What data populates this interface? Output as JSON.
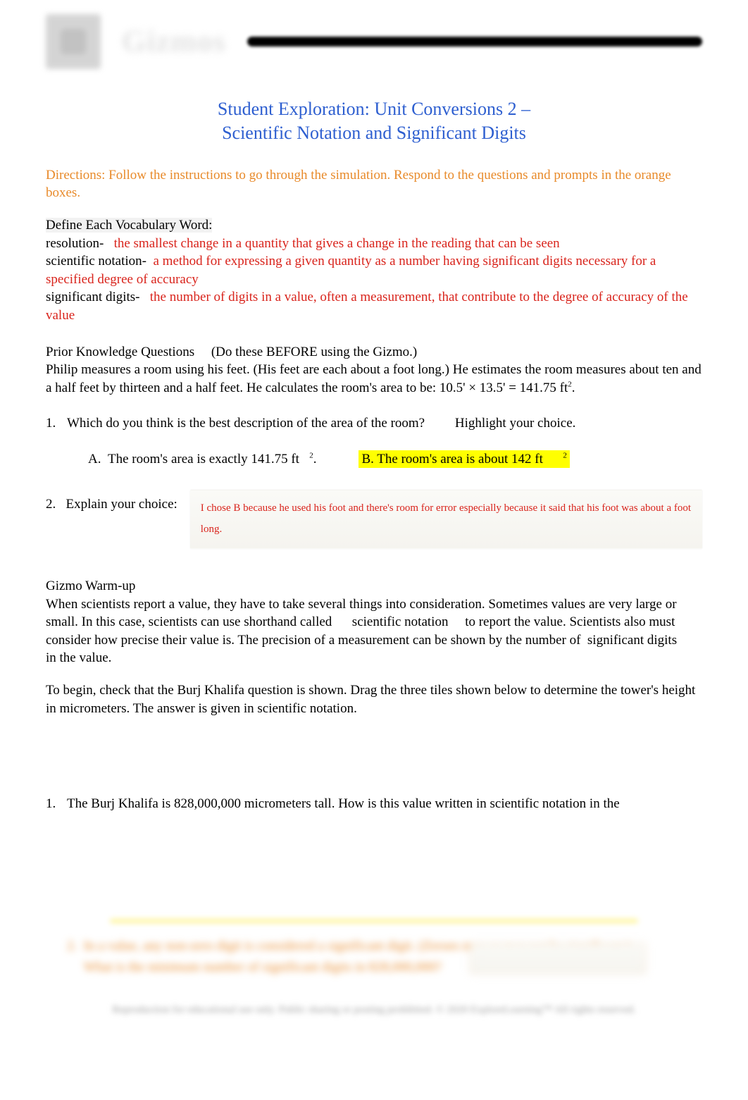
{
  "header": {
    "brand": "Gizmos"
  },
  "title": {
    "line1": "Student Exploration: Unit Conversions 2 –",
    "line2": "Scientific Notation and Significant Digits"
  },
  "directions": "Directions: Follow the instructions to go through the simulation. Respond to the questions and prompts in the orange boxes.",
  "vocab": {
    "heading": "Define Each Vocabulary Word:",
    "resolution_term": "resolution-",
    "resolution_def": "the smallest change in a quantity that gives a change in the reading that can be seen",
    "scinot_term": "scientific notation-",
    "scinot_def": "a method for expressing a given quantity as a number having significant digits necessary for a specified degree of accuracy",
    "sigdig_term": "significant digits-",
    "sigdig_def": "the number of digits in a value, often a measurement, that contribute to the degree of accuracy of the value"
  },
  "prior": {
    "heading": "Prior Knowledge Questions ",
    "note": "(Do these BEFORE using the Gizmo.)",
    "body": "Philip measures a room using his feet. (His feet are each about a foot long.) He estimates the room measures about ten and a half feet by thirteen and a half feet. He calculates the room's area to be: 10.5' × 13.5' = 141.75 ft",
    "body_sup": "2",
    "body_end": "."
  },
  "q1": {
    "num": "1.",
    "text_a": "Which do you think is the best description of the area of the room? ",
    "highlight_word": "Highlight",
    "text_b": " your choice.",
    "choiceA_letter": "A.",
    "choiceA_text": "The room's area is exactly 141.75 ft",
    "choiceA_sup": "2",
    "choiceA_end": ".",
    "choiceB_text": "B.  The room's area is about 142 ft",
    "choiceB_sup": "2"
  },
  "q2": {
    "num": "2.",
    "label": "Explain your choice:",
    "answer": "I chose B because he used his foot and there's room for error especially because it said that his foot was about a foot long."
  },
  "warmup": {
    "heading": "Gizmo Warm-up",
    "p1a": "When scientists report a value, they have to take several things into consideration. Sometimes values are very large or small. In this case, scientists can use shorthand called ",
    "p1_term1": "scientific notation",
    "p1b": " to report the value. Scientists also must consider how precise their value is. The precision of a measurement can be shown by the number of ",
    "p1_term2": "significant digits",
    "p1c": " in the value.",
    "p2": "To begin, check that the Burj Khalifa question is shown. Drag the three tiles shown below to determine the tower's height in micrometers. The answer is given in scientific notation."
  },
  "q_burj": {
    "num": "1.",
    "text": "The Burj Khalifa is 828,000,000 micrometers tall. How is this value written in scientific notation in the"
  },
  "blurred": {
    "q_num": "2.",
    "line1": "In a value, any non-zero digit is considered a significant digit. (Zeroes may or may not be significant.)",
    "line2": "What is the minimum number of significant digits in 828,000,000?"
  },
  "footer": "Reproduction for educational use only. Public sharing or posting prohibited. © 2020 ExploreLearning™ All rights reserved."
}
